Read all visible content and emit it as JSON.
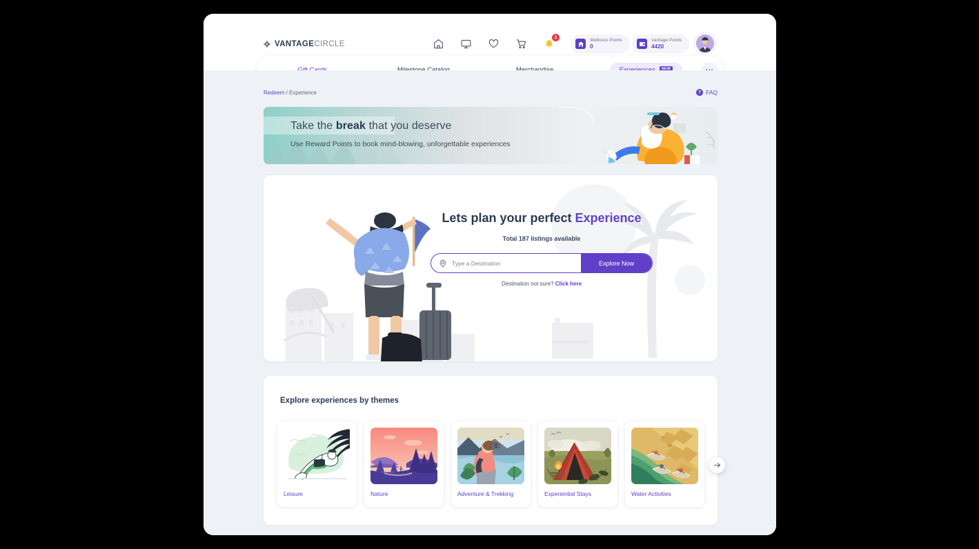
{
  "brand": {
    "name_bold": "VANTAGE",
    "name_light": "CIRCLE",
    "accent": "#6040c8",
    "dark": "#2b3a55"
  },
  "header": {
    "icons": [
      {
        "name": "home-icon",
        "label": "Home"
      },
      {
        "name": "monitor-icon",
        "label": "Dashboard"
      },
      {
        "name": "heart-icon",
        "label": "Wishlist"
      },
      {
        "name": "cart-icon",
        "label": "Cart"
      },
      {
        "name": "bell-icon",
        "label": "Notifications"
      }
    ],
    "notification_count": "1",
    "wellness": {
      "label": "Wellness Points",
      "value": "0",
      "icon": "house-icon"
    },
    "vantage": {
      "label": "Vantage Points",
      "value": "4420",
      "icon": "wallet-icon"
    },
    "avatar": {
      "name": "user-avatar"
    }
  },
  "nav": {
    "tabs": [
      {
        "label": "Gift Cards",
        "active": false,
        "style": "link"
      },
      {
        "label": "Milestone Catalog",
        "active": false,
        "style": "plain"
      },
      {
        "label": "Merchandise",
        "active": false,
        "style": "plain"
      }
    ],
    "active_tab": {
      "label": "Experiences",
      "badge": "NEW"
    },
    "more_label": "More"
  },
  "breadcrumb": {
    "root": "Redeem",
    "separator": "/",
    "current": "Experience"
  },
  "faq": {
    "icon_glyph": "?",
    "label": "FAQ"
  },
  "banner": {
    "title_prefix": "Take the ",
    "title_bold": "break",
    "title_suffix": " that you deserve",
    "subtitle": "Use Reward Points to book mind-blowing, unforgettable experiences"
  },
  "hero": {
    "title_prefix": "Lets plan your perfect ",
    "title_accent": "Experience",
    "count_text": "Total 187 listings available",
    "search_placeholder": "Type a Destination",
    "search_value": "",
    "explore_label": "Explore Now",
    "hint_text": "Destination not sure? ",
    "hint_link": "Click here"
  },
  "themes": {
    "title": "Explore experiences by themes",
    "cards": [
      {
        "label": "Leisure",
        "art": "leisure"
      },
      {
        "label": "Nature",
        "art": "nature"
      },
      {
        "label": "Adventure & Trekking",
        "art": "adventure"
      },
      {
        "label": "Experiential Stays",
        "art": "camping"
      },
      {
        "label": "Water Activities",
        "art": "water"
      }
    ],
    "next_label": "Next"
  }
}
